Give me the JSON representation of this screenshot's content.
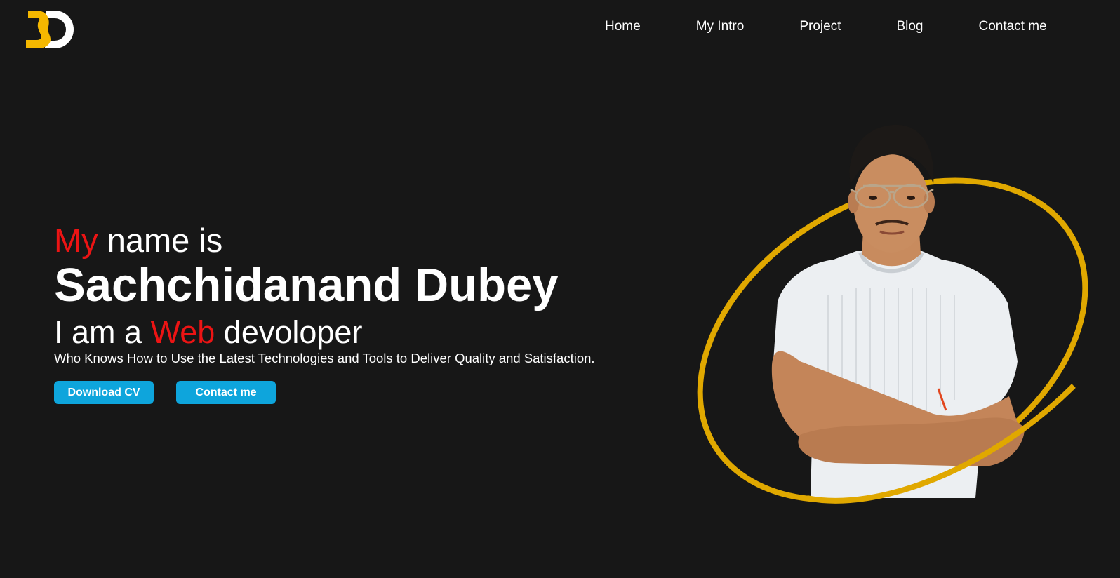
{
  "brand": {
    "logo_text": "SD",
    "logo_colors": {
      "s": "#f5b800",
      "d": "#ffffff"
    }
  },
  "nav": {
    "items": [
      {
        "label": "Home"
      },
      {
        "label": "My Intro"
      },
      {
        "label": "Project"
      },
      {
        "label": "Blog"
      },
      {
        "label": "Contact me"
      }
    ]
  },
  "hero": {
    "intro_highlight": "My",
    "intro_rest": "name is",
    "name": "Sachchidanand Dubey",
    "role_prefix": "I am a",
    "role_highlight": "Web",
    "role_suffix": "devoloper",
    "tagline": "Who Knows How to Use the Latest Technologies and Tools to Deliver Quality and Satisfaction.",
    "buttons": {
      "download_cv": "Download CV",
      "contact": "Contact me"
    }
  },
  "theme": {
    "background": "#171717",
    "accent_red": "#ec1414",
    "button_blue": "#0ea5dc",
    "ring_gold": "#e0a800",
    "text": "#ffffff"
  },
  "portrait": {
    "icon": "person-portrait-icon",
    "ring_icon": "gold-ring-icon"
  }
}
